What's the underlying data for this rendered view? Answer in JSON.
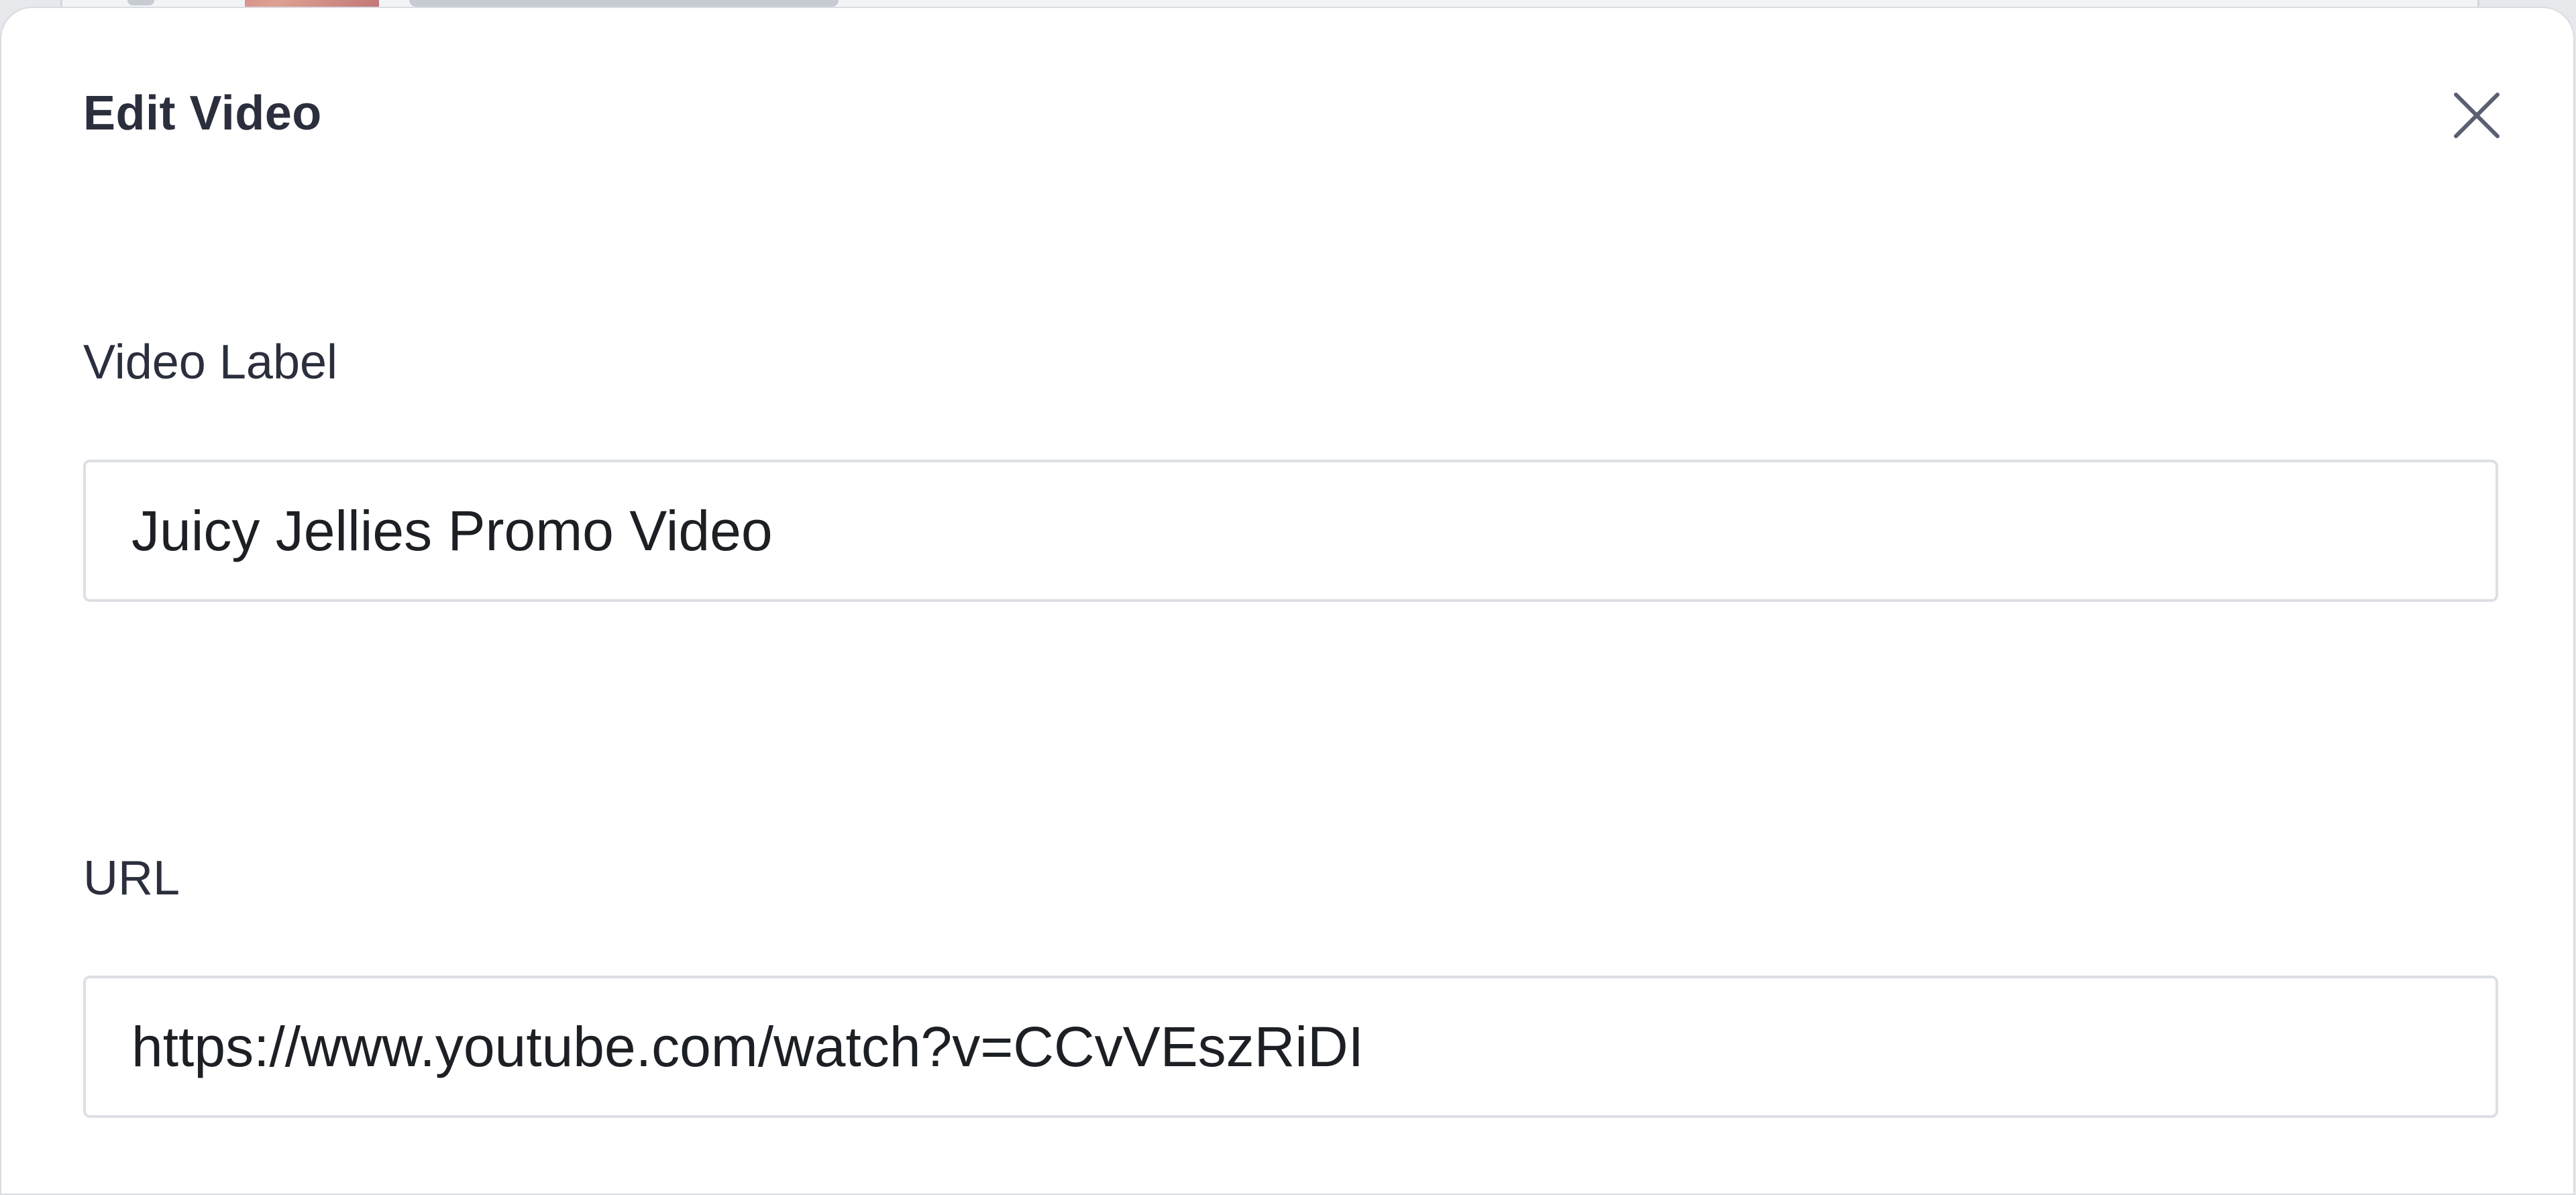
{
  "modal": {
    "title": "Edit Video",
    "close_icon": "close-icon"
  },
  "form": {
    "video_label": {
      "label": "Video Label",
      "value": "Juicy Jellies Promo Video"
    },
    "url": {
      "label": "URL",
      "value": "https://www.youtube.com/watch?v=CCvVEszRiDI"
    }
  },
  "colors": {
    "title_text": "#2b2f3d",
    "input_border": "#dcdfe4",
    "close_icon": "#5a6072"
  }
}
